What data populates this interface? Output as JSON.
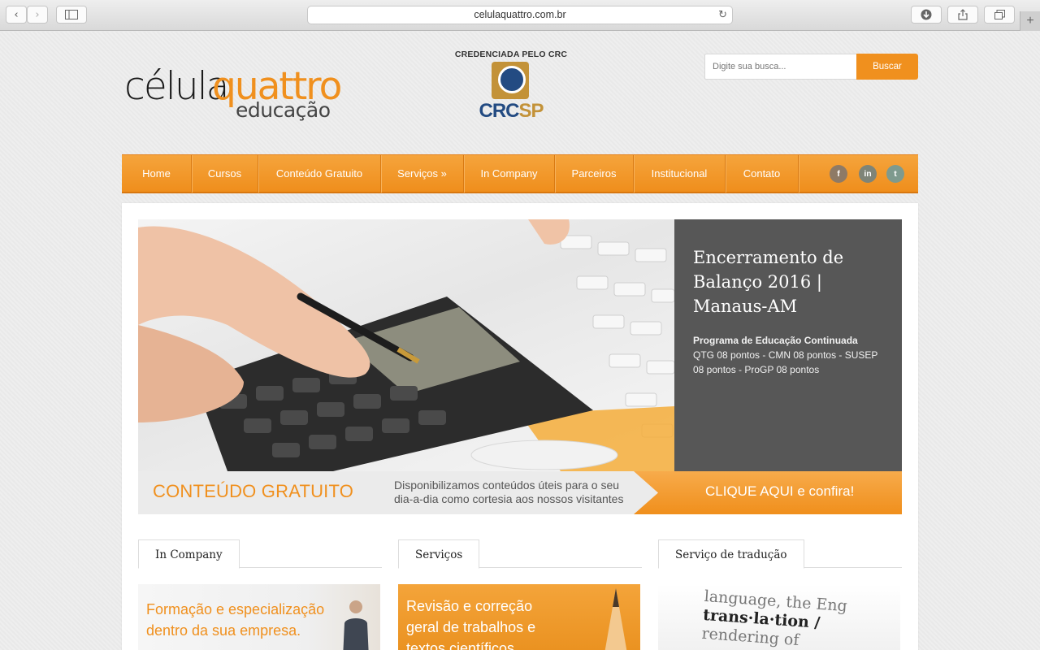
{
  "browser": {
    "url": "celulaquattro.com.br",
    "reload_icon": "reload-icon",
    "tab_plus": "+"
  },
  "header": {
    "logo_word1": "célula",
    "logo_word2": "quattro",
    "logo_word3": "educação",
    "crc_top": "CREDENCIADA PELO CRC",
    "crc_a": "CRC",
    "crc_b": "SP",
    "search_placeholder": "Digite sua busca...",
    "search_button": "Buscar"
  },
  "nav": {
    "items": [
      "Home",
      "Cursos",
      "Conteúdo Gratuito",
      "Serviços »",
      "In Company",
      "Parceiros",
      "Institucional",
      "Contato"
    ],
    "social": [
      "f",
      "in",
      "t"
    ]
  },
  "hero": {
    "title": "Encerramento de Balanço 2016 | Manaus-AM",
    "desc_bold": "Programa de Educação Continuada",
    "desc_text": "QTG 08 pontos - CMN 08 pontos - SUSEP 08 pontos - ProGP 08 pontos"
  },
  "banner": {
    "left": "CONTEÚDO GRATUITO",
    "mid_line1": "Disponibilizamos conteúdos úteis para o seu",
    "mid_line2": "dia-a-dia como cortesia aos nossos visitantes",
    "cta": "CLIQUE AQUI e confira!"
  },
  "columns": [
    {
      "tab": "In Company",
      "card_line1": "Formação e especialização",
      "card_line2": "dentro da sua empresa."
    },
    {
      "tab": "Serviços",
      "card_line1": "Revisão e correção",
      "card_line2": "geral de trabalhos e",
      "card_line3": "textos científicos"
    },
    {
      "tab": "Serviço de tradução",
      "card_line1": "language, the Eng",
      "card_line2": "trans·la·tion /",
      "card_line3": "rendering of"
    }
  ],
  "colors": {
    "accent": "#f0901e",
    "caption_bg": "#575757",
    "crc_blue": "#234b82",
    "crc_gold": "#c39238"
  }
}
